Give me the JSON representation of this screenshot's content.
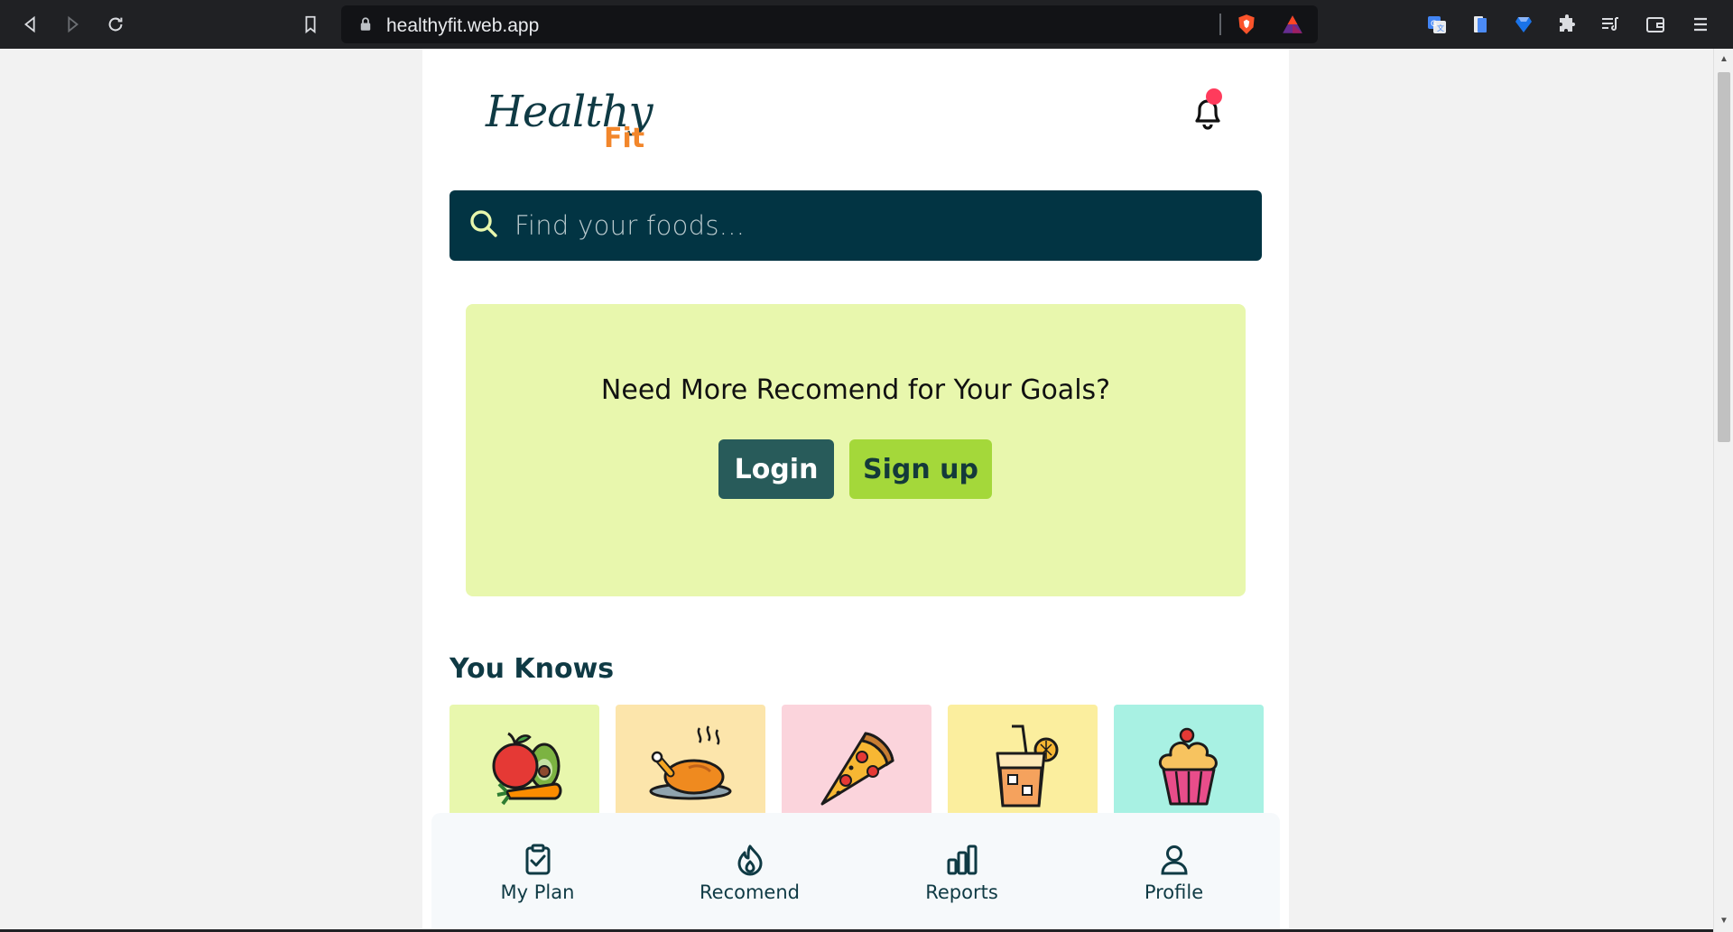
{
  "browser": {
    "url": "healthyfit.web.app",
    "accent_color": "#202124"
  },
  "app": {
    "logo_text_main": "Healthy",
    "logo_text_sub": "Fit",
    "brand_colors": {
      "primary": "#023443",
      "accent": "#f2862b",
      "lime": "#a4d83a",
      "promo_bg": "#e8f7ad"
    },
    "search": {
      "placeholder": "Find your foods..."
    },
    "promo": {
      "title": "Need More Recomend for Your Goals?",
      "login_label": "Login",
      "signup_label": "Sign up"
    },
    "you_knows": {
      "title": "You Knows",
      "cards": [
        {
          "icon": "fruits-vegetables-icon",
          "bg": "#e8f7ad"
        },
        {
          "icon": "roast-chicken-icon",
          "bg": "#fce5ab"
        },
        {
          "icon": "pizza-icon",
          "bg": "#fbd4dc"
        },
        {
          "icon": "iced-drink-icon",
          "bg": "#fbee9e"
        },
        {
          "icon": "cupcake-icon",
          "bg": "#a8f1e3"
        }
      ]
    },
    "bottom_nav": [
      {
        "label": "My Plan",
        "icon": "clipboard-check-icon"
      },
      {
        "label": "Recomend",
        "icon": "flame-icon"
      },
      {
        "label": "Reports",
        "icon": "bar-chart-icon"
      },
      {
        "label": "Profile",
        "icon": "user-icon"
      }
    ]
  }
}
